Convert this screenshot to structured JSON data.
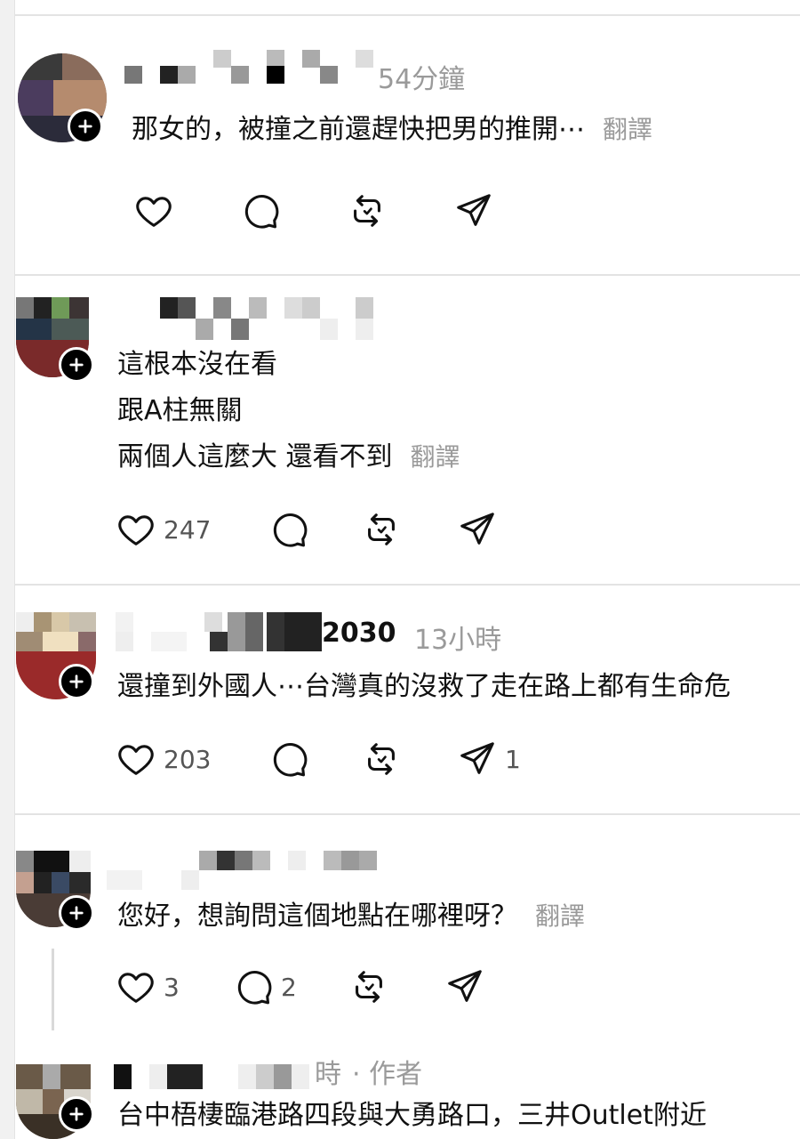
{
  "comments": [
    {
      "time": "54分鐘",
      "lines": [
        "那女的，被撞之前還趕快把男的推開⋯"
      ],
      "translate": "翻譯",
      "likes": "",
      "replies": "",
      "shares": ""
    },
    {
      "time": "",
      "lines": [
        "這根本沒在看",
        "跟A柱無關",
        "兩個人這麼大 還看不到"
      ],
      "translate": "翻譯",
      "likes": "247",
      "replies": "",
      "shares": ""
    },
    {
      "name_suffix": "2030",
      "time": "13小時",
      "lines": [
        "還撞到外國人⋯台灣真的沒救了走在路上都有生命危"
      ],
      "translate": "",
      "likes": "203",
      "replies": "",
      "shares": "1"
    },
    {
      "time": "",
      "lines": [
        "您好，想詢問這個地點在哪裡呀？"
      ],
      "translate": "翻譯",
      "likes": "3",
      "replies": "2",
      "shares": ""
    },
    {
      "time": "時",
      "author_tag": "· 作者",
      "lines": [
        "台中梧棲臨港路四段與大勇路口，三井Outlet附近"
      ],
      "translate": "",
      "likes": "",
      "replies": "",
      "shares": ""
    }
  ],
  "icons": {
    "like": "heart-icon",
    "reply": "comment-icon",
    "repost": "repost-icon",
    "share": "send-icon",
    "follow": "plus-icon"
  },
  "colors": {
    "text": "#111111",
    "muted": "#9a9a9a",
    "divider": "#e3e3e3"
  }
}
